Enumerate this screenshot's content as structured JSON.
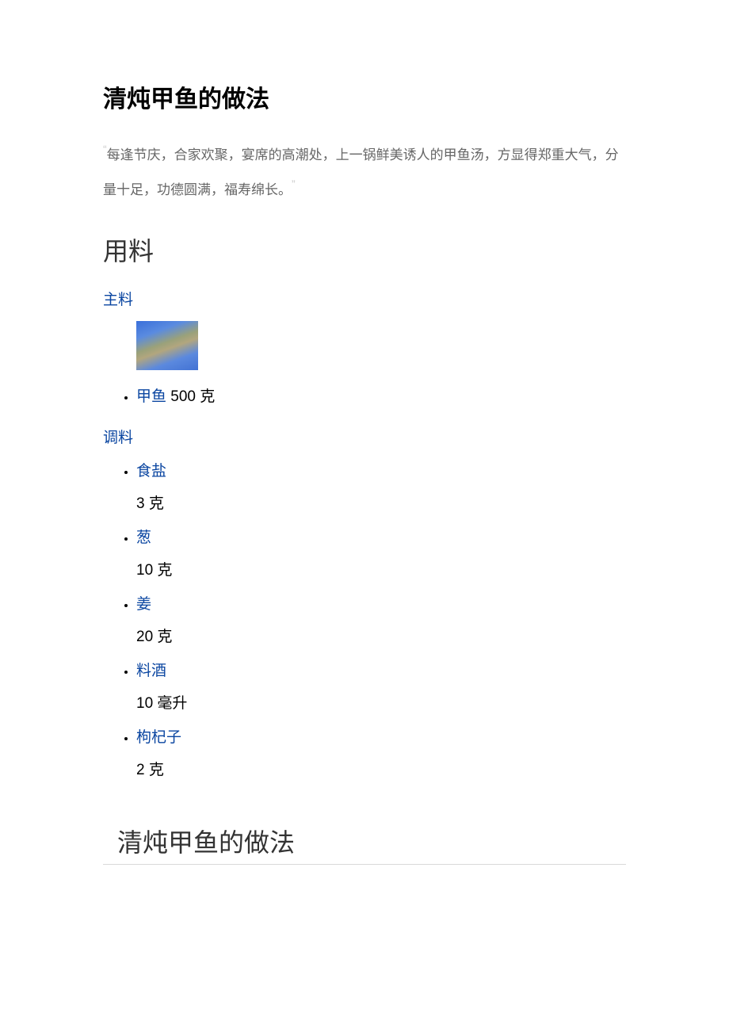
{
  "title": "清炖甲鱼的做法",
  "description": "每逢节庆，合家欢聚，宴席的高潮处，上一锅鲜美诱人的甲鱼汤，方显得郑重大气，分量十足，功德圆满，福寿绵长。",
  "sections": {
    "ingredients_heading": "用料",
    "main_label": "主料",
    "seasoning_label": "调料",
    "method_heading": "清炖甲鱼的做法"
  },
  "main_ingredient": {
    "name": "甲鱼",
    "amount": "500 克"
  },
  "seasonings": [
    {
      "name": "食盐",
      "amount": "3 克"
    },
    {
      "name": "葱",
      "amount": "10 克"
    },
    {
      "name": "姜",
      "amount": "20 克"
    },
    {
      "name": "料酒",
      "amount": "10 毫升"
    },
    {
      "name": "枸杞子",
      "amount": "2 克"
    }
  ]
}
